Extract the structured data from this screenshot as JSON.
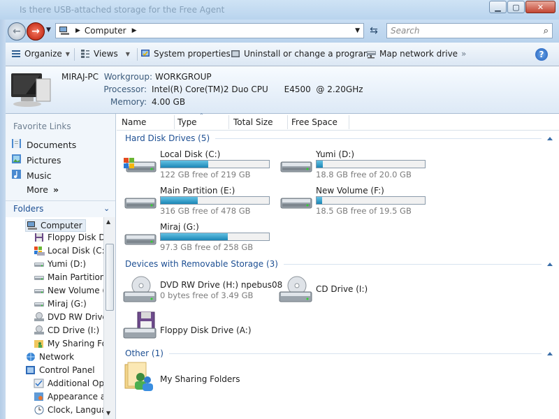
{
  "window": {
    "title": "Is there USB-attached storage for the Free Agent",
    "icons": [
      "minimize-icon",
      "maximize-icon",
      "close-icon"
    ]
  },
  "address": {
    "path_root_icon": "computer-icon",
    "crumb": "Computer",
    "search_placeholder": "Search"
  },
  "toolbar": {
    "organize": "Organize",
    "views": "Views",
    "system_properties": "System properties",
    "uninstall": "Uninstall or change a program",
    "map_drive": "Map network drive",
    "more": "»"
  },
  "details": {
    "computer_name": "MIRAJ-PC",
    "workgroup_label": "Workgroup:",
    "workgroup": "WORKGROUP",
    "processor_label": "Processor:",
    "processor": "Intel(R) Core(TM)2 Duo CPU      E4500  @ 2.20GHz",
    "memory_label": "Memory:",
    "memory": "4.00 GB"
  },
  "nav": {
    "favorite_links_title": "Favorite Links",
    "favorites": [
      "Documents",
      "Pictures",
      "Music"
    ],
    "more": "More",
    "more_arrow": "»",
    "folders_title": "Folders",
    "tree": [
      "Computer",
      "Floppy Disk Dr",
      "Local Disk (C:)",
      "Yumi (D:)",
      "Main Partition",
      "New Volume (",
      "Miraj (G:)",
      "DVD RW Drive",
      "CD Drive (I:)",
      "My Sharing Fo",
      "Network",
      "Control Panel",
      "Additional Opt",
      "Appearance ar",
      "Clock, Langua"
    ]
  },
  "columns": {
    "name": "Name",
    "type": "Type",
    "total_size": "Total Size",
    "free_space": "Free Space"
  },
  "groups": {
    "hdd": "Hard Disk Drives (5)",
    "removable": "Devices with Removable Storage (3)",
    "other": "Other (1)"
  },
  "drives": [
    {
      "name": "Local Disk (C:)",
      "free": "122 GB free of 219 GB",
      "used_fraction": 0.44
    },
    {
      "name": "Yumi (D:)",
      "free": "18.8 GB free of 20.0 GB",
      "used_fraction": 0.06
    },
    {
      "name": "Main Partition (E:)",
      "free": "316 GB free of 478 GB",
      "used_fraction": 0.34
    },
    {
      "name": "New Volume (F:)",
      "free": "18.5 GB free of 19.5 GB",
      "used_fraction": 0.05
    },
    {
      "name": "Miraj (G:)",
      "free": "97.3 GB free of 258 GB",
      "used_fraction": 0.62
    }
  ],
  "removable": [
    {
      "name": "DVD RW Drive (H:) npebus08",
      "free": "0 bytes free of 3.49 GB"
    },
    {
      "name": "CD Drive (I:)"
    },
    {
      "name": "Floppy Disk Drive (A:)"
    }
  ],
  "other": [
    {
      "name": "My Sharing Folders"
    }
  ]
}
